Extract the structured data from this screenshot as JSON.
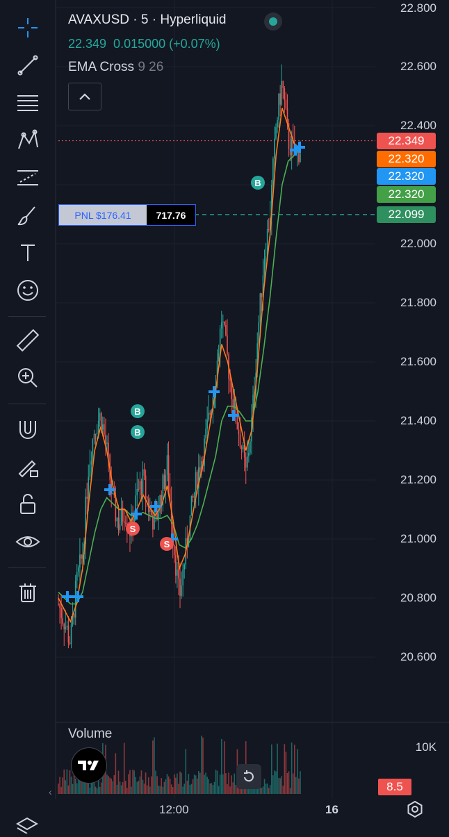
{
  "header": {
    "symbol": "AVAXUSD",
    "interval": "5",
    "exchange": "Hyperliquid",
    "price_line": "22.349  0.015000 (+0.07%)",
    "indicator_name": "EMA Cross",
    "indicator_params": "9 26"
  },
  "pnl": {
    "label": "PNL $176.41",
    "qty": "717.76"
  },
  "price_tags": {
    "last": "22.349",
    "ema_fast": "22.320",
    "ema_slow": "22.320",
    "cross": "22.320",
    "position": "22.099"
  },
  "volume": {
    "title": "Volume",
    "axis_label": "10K",
    "last": "8.5"
  },
  "time_axis": {
    "noon": "12:00",
    "day": "16"
  },
  "markers": {
    "buy": "B",
    "sell": "S"
  },
  "toolbar": {
    "tools": [
      "crosshair-icon",
      "trend-line-icon",
      "fib-icon",
      "pattern-icon",
      "prediction-icon",
      "brush-icon",
      "text-icon",
      "emoji-icon",
      "ruler-icon",
      "zoom-in-icon",
      "magnet-icon",
      "lock-drawing-icon",
      "unlock-icon",
      "eye-icon",
      "trash-icon"
    ]
  },
  "colors": {
    "background": "#131722",
    "up": "#26a69a",
    "down": "#ef5350",
    "ema_fast": "#ff7a1a",
    "ema_slow": "#4caf50",
    "cross": "#2196f3",
    "position": "#2e8f5f"
  },
  "chart_data": {
    "type": "candlestick",
    "y_ticks": [
      "22.800",
      "22.600",
      "22.400",
      "22.000",
      "21.800",
      "21.600",
      "21.400",
      "21.200",
      "21.000",
      "20.800",
      "20.600"
    ],
    "ylim": [
      20.55,
      22.8
    ],
    "close_path": [
      20.78,
      20.72,
      20.65,
      20.85,
      20.95,
      21.25,
      21.38,
      21.42,
      21.3,
      21.12,
      21.05,
      21.1,
      21.02,
      21.15,
      21.2,
      21.1,
      21.05,
      21.15,
      21.25,
      21.0,
      20.8,
      20.95,
      21.1,
      21.22,
      21.3,
      21.42,
      21.55,
      21.75,
      21.6,
      21.45,
      21.35,
      21.22,
      21.4,
      21.7,
      21.95,
      22.1,
      22.4,
      22.55,
      22.35,
      22.3,
      22.32
    ],
    "ema_fast_path": [
      20.8,
      20.76,
      20.72,
      20.78,
      20.9,
      21.12,
      21.3,
      21.38,
      21.3,
      21.18,
      21.1,
      21.1,
      21.06,
      21.1,
      21.15,
      21.11,
      21.08,
      21.11,
      21.18,
      21.06,
      20.9,
      20.95,
      21.06,
      21.17,
      21.26,
      21.38,
      21.5,
      21.66,
      21.6,
      21.5,
      21.4,
      21.3,
      21.37,
      21.6,
      21.85,
      22.03,
      22.3,
      22.46,
      22.4,
      22.34,
      22.32
    ],
    "ema_slow_path": [
      20.82,
      20.8,
      20.78,
      20.78,
      20.82,
      20.92,
      21.02,
      21.1,
      21.14,
      21.12,
      21.1,
      21.1,
      21.08,
      21.08,
      21.09,
      21.08,
      21.07,
      21.07,
      21.08,
      21.05,
      20.98,
      20.97,
      21.0,
      21.05,
      21.12,
      21.2,
      21.28,
      21.4,
      21.45,
      21.45,
      21.43,
      21.4,
      21.4,
      21.5,
      21.65,
      21.82,
      22.02,
      22.2,
      22.28,
      22.3,
      22.32
    ],
    "buy_markers": [
      "B",
      "B",
      "B"
    ],
    "sell_markers": [
      "S",
      "S"
    ]
  }
}
